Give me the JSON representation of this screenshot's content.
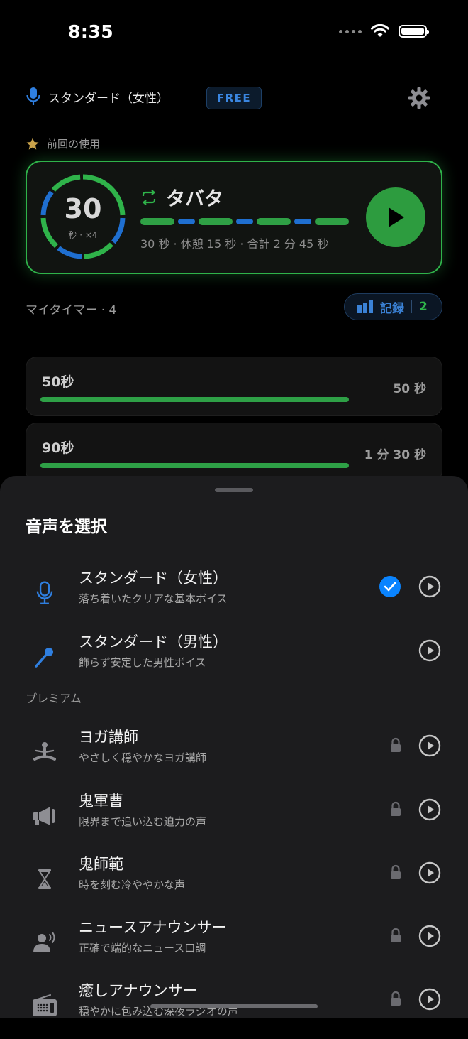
{
  "status": {
    "time": "8:35"
  },
  "header": {
    "voice_label": "スタンダード（女性）",
    "plan_badge": "FREE"
  },
  "recent": {
    "label": "前回の使用",
    "round_seconds": "30",
    "round_sub": "秒 · ×4",
    "title": "タバタ",
    "detail": "30 秒 · 休憩 15 秒 · 合計 2 分 45 秒"
  },
  "my_timers": {
    "label": "マイタイマー · 4",
    "records_label": "記録",
    "records_count": "2",
    "items": [
      {
        "name": "50秒",
        "duration": "50 秒",
        "progress": 1.0
      },
      {
        "name": "90秒",
        "duration": "1 分 30 秒",
        "progress": 1.0
      }
    ]
  },
  "sheet": {
    "title": "音声を選択",
    "premium_label": "プレミアム",
    "standard": [
      {
        "name": "スタンダード（女性）",
        "desc": "落ち着いたクリアな基本ボイス",
        "selected": true,
        "icon": "microphone-icon"
      },
      {
        "name": "スタンダード（男性）",
        "desc": "飾らず安定した男性ボイス",
        "selected": false,
        "icon": "handheld-mic-icon"
      }
    ],
    "premium": [
      {
        "name": "ヨガ講師",
        "desc": "やさしく穏やかなヨガ講師",
        "icon": "meditation-icon"
      },
      {
        "name": "鬼軍曹",
        "desc": "限界まで追い込む迫力の声",
        "icon": "megaphone-icon"
      },
      {
        "name": "鬼師範",
        "desc": "時を刻む冷ややかな声",
        "icon": "hourglass-icon"
      },
      {
        "name": "ニュースアナウンサー",
        "desc": "正確で端的なニュース口調",
        "icon": "announcer-icon"
      },
      {
        "name": "癒しアナウンサー",
        "desc": "穏やかに包み込む深夜ラジオの声",
        "icon": "radio-icon"
      }
    ]
  },
  "colors": {
    "accent_green": "#2fb34a",
    "accent_blue": "#0a84ff",
    "rest_blue": "#1f6fd0"
  }
}
